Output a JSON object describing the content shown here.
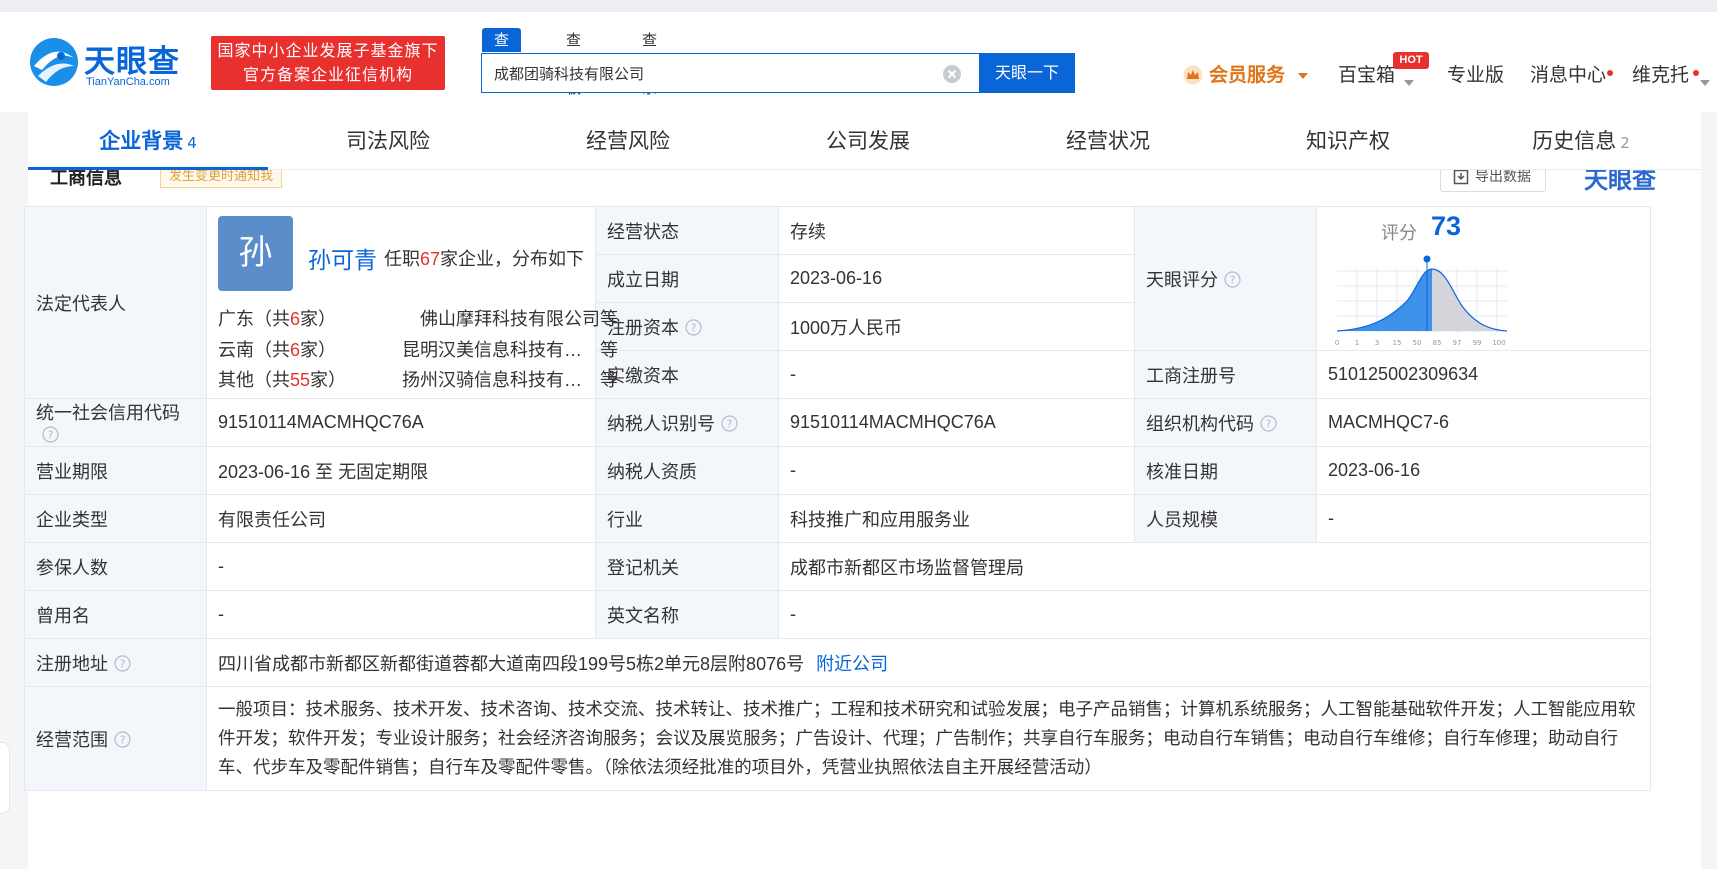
{
  "header": {
    "logo_text": "天眼查",
    "logo_sub": "TianYanCha.com",
    "badge_line1": "国家中小企业发展子基金旗下",
    "badge_line2": "官方备案企业征信机构",
    "search_tabs": [
      "查公司",
      "查老板",
      "查关系"
    ],
    "search_value": "成都团骑科技有限公司",
    "search_button": "天眼一下",
    "vip": "会员服务",
    "toolbox": "百宝箱",
    "hot": "HOT",
    "pro": "专业版",
    "messages": "消息中心",
    "user": "维克托"
  },
  "tabs": [
    {
      "label": "企业背景",
      "count": "4"
    },
    {
      "label": "司法风险",
      "count": ""
    },
    {
      "label": "经营风险",
      "count": ""
    },
    {
      "label": "公司发展",
      "count": ""
    },
    {
      "label": "经营状况",
      "count": ""
    },
    {
      "label": "知识产权",
      "count": ""
    },
    {
      "label": "历史信息",
      "count": "2"
    }
  ],
  "section": {
    "title": "工商信息",
    "badge": "发生变更时通知我",
    "export": "导出数据",
    "watermark": "天眼查"
  },
  "legal": {
    "label": "法定代表人",
    "avatar_char": "孙",
    "name": "孙可青",
    "jobs_prefix": "任职",
    "jobs_count": "67",
    "jobs_suffix": "家企业，分布如下",
    "regions": [
      {
        "prefix": "广东（共",
        "count": "6",
        "suffix": "家）",
        "company": "佛山摩拜科技有限公司等"
      },
      {
        "prefix": "云南（共",
        "count": "6",
        "suffix": "家）",
        "company": "昆明汉美信息科技有…　等"
      },
      {
        "prefix": "其他（共",
        "count": "55",
        "suffix": "家）",
        "company": "扬州汉骑信息科技有…　等"
      }
    ]
  },
  "score": {
    "label": "天眼评分",
    "score_label": "评分",
    "value": "73",
    "ticks": [
      "0",
      "1",
      "3",
      "15",
      "50",
      "85",
      "97",
      "99",
      "100"
    ]
  },
  "fields": {
    "status_label": "经营状态",
    "status": "存续",
    "founded_label": "成立日期",
    "founded": "2023-06-16",
    "capital_label": "注册资本",
    "capital": "1000万人民币",
    "paid_label": "实缴资本",
    "paid": "-",
    "regno_label": "工商注册号",
    "regno": "510125002309634",
    "credit_label": "统一社会信用代码",
    "credit": "91510114MACMHQC76A",
    "taxid_label": "纳税人识别号",
    "taxid": "91510114MACMHQC76A",
    "org_label": "组织机构代码",
    "org": "MACMHQC7-6",
    "term_label": "营业期限",
    "term": "2023-06-16 至 无固定期限",
    "taxqual_label": "纳税人资质",
    "taxqual": "-",
    "approve_label": "核准日期",
    "approve": "2023-06-16",
    "type_label": "企业类型",
    "type": "有限责任公司",
    "industry_label": "行业",
    "industry": "科技推广和应用服务业",
    "staff_label": "人员规模",
    "staff": "-",
    "insured_label": "参保人数",
    "insured": "-",
    "authority_label": "登记机关",
    "authority": "成都市新都区市场监督管理局",
    "former_label": "曾用名",
    "former": "-",
    "english_label": "英文名称",
    "english": "-",
    "address_label": "注册地址",
    "address": "四川省成都市新都区新都街道蓉都大道南四段199号5栋2单元8层附8076号",
    "nearby": "附近公司",
    "scope_label": "经营范围",
    "scope": "一般项目：技术服务、技术开发、技术咨询、技术交流、技术转让、技术推广；工程和技术研究和试验发展；电子产品销售；计算机系统服务；人工智能基础软件开发；人工智能应用软件开发；软件开发；专业设计服务；社会经济咨询服务；会议及展览服务；广告设计、代理；广告制作；共享自行车服务；电动自行车销售；电动自行车维修；自行车修理；助动自行车、代步车及零配件销售；自行车及零配件零售。（除依法须经批准的项目外，凭营业执照依法自主开展经营活动）"
  },
  "colors": {
    "brand": "#0a65d8",
    "red": "#e8312f",
    "vip": "#e0741a",
    "label_bg": "#f3f6fb"
  }
}
